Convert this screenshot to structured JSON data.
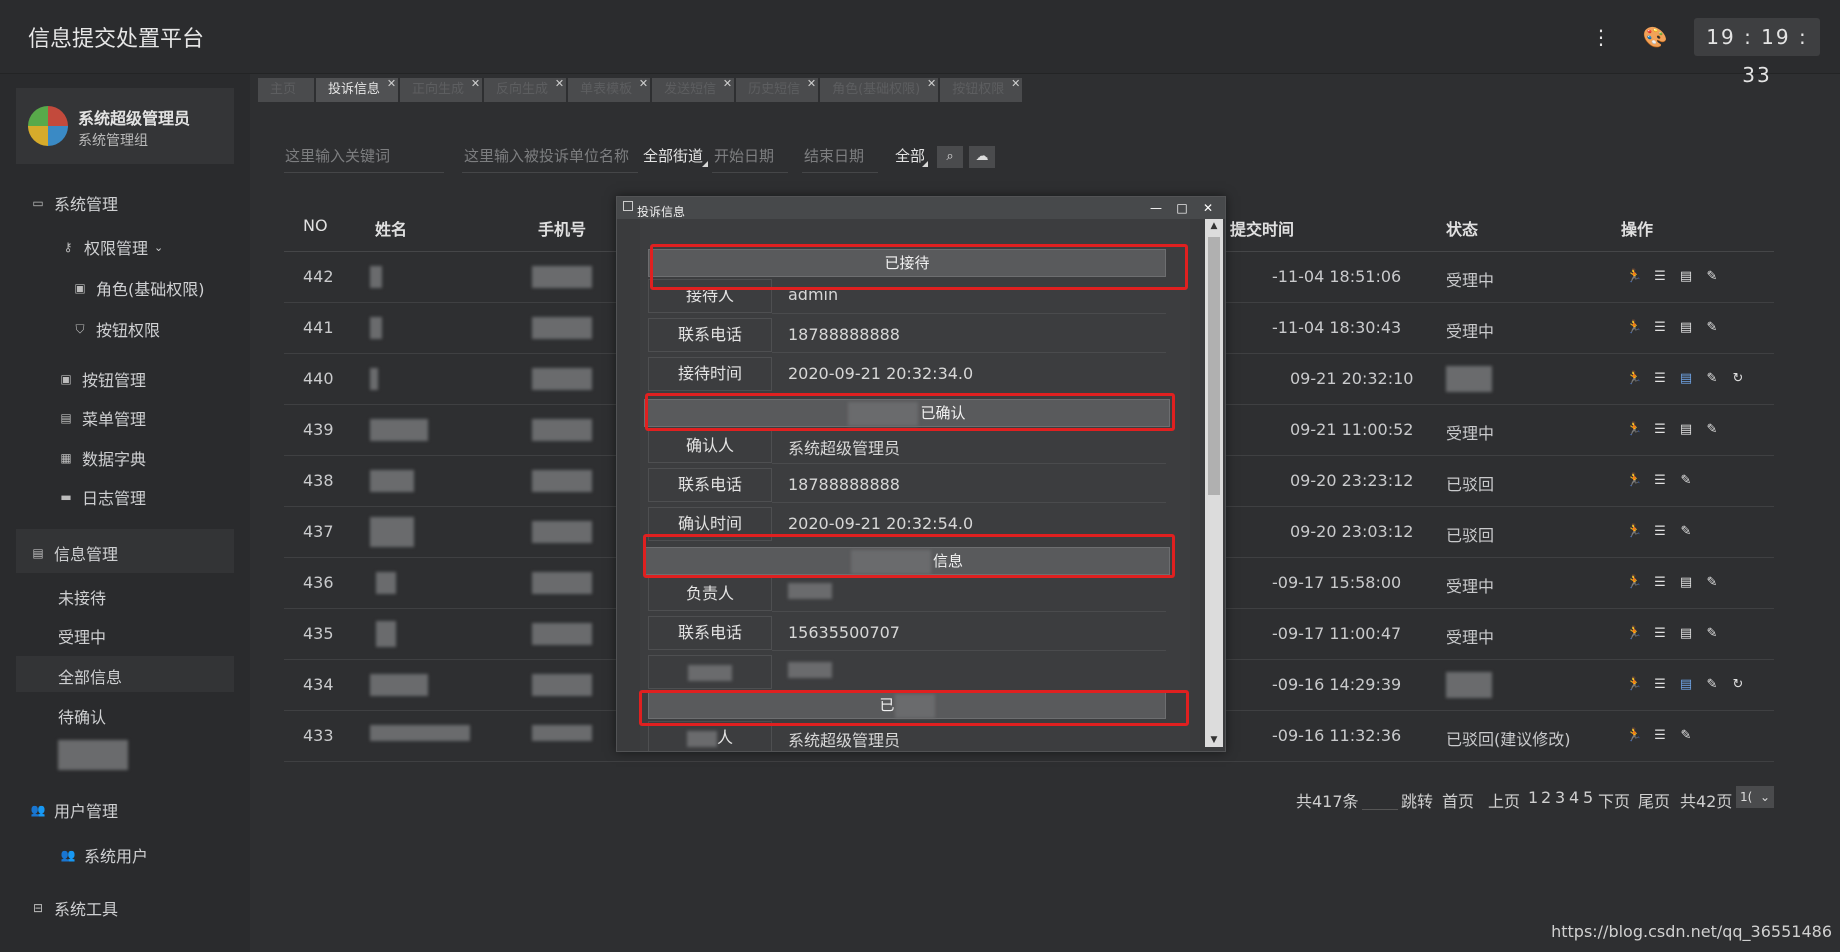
{
  "header": {
    "title": "信息提交处置平台",
    "time": "19 : 19 : 33",
    "more_icon": "more-vertical-icon",
    "theme_icon": "palette-icon"
  },
  "sidebar": {
    "user_name": "系统超级管理员",
    "user_group": "系统管理组",
    "system_mgmt": "系统管理",
    "perm_mgmt": "权限管理",
    "role_perm": "角色(基础权限)",
    "button_perm": "按钮权限",
    "button_mgmt": "按钮管理",
    "menu_mgmt": "菜单管理",
    "data_dict": "数据字典",
    "log_mgmt": "日志管理",
    "info_mgmt": "信息管理",
    "not_received": "未接待",
    "in_process": "受理中",
    "all_info": "全部信息",
    "to_confirm": "待确认",
    "user_mgmt": "用户管理",
    "system_users": "系统用户",
    "system_tools": "系统工具"
  },
  "tabs": [
    "主页",
    "投诉信息",
    "正向生成",
    "反向生成",
    "单表模板",
    "发送短信",
    "历史短信",
    "角色(基础权限)",
    "按钮权限"
  ],
  "filters": {
    "keyword_placeholder": "这里输入关键词",
    "unit_placeholder": "这里输入被投诉单位名称",
    "street": "全部街道",
    "start_date": "开始日期",
    "end_date": "结束日期",
    "status": "全部"
  },
  "table": {
    "headers": {
      "no": "NO",
      "name": "姓名",
      "phone": "手机号",
      "submit_time": "提交时间",
      "status": "状态",
      "actions": "操作"
    },
    "rows": [
      {
        "no": "442",
        "time": "-11-04 18:51:06",
        "status": "受理中"
      },
      {
        "no": "441",
        "time": "-11-04 18:30:43",
        "status": "受理中"
      },
      {
        "no": "440",
        "time": "09-21 20:32:10",
        "status": ""
      },
      {
        "no": "439",
        "time": "09-21 11:00:52",
        "status": "受理中"
      },
      {
        "no": "438",
        "time": "09-20 23:23:12",
        "status": "已驳回"
      },
      {
        "no": "437",
        "time": "09-20 23:03:12",
        "status": "已驳回"
      },
      {
        "no": "436",
        "time": "-09-17 15:58:00",
        "status": "受理中"
      },
      {
        "no": "435",
        "time": "-09-17 11:00:47",
        "status": "受理中"
      },
      {
        "no": "434",
        "time": "-09-16 14:29:39",
        "status": ""
      },
      {
        "no": "433",
        "time": "-09-16 11:32:36",
        "status": "已驳回(建议修改)"
      }
    ]
  },
  "pagination": {
    "total": "共417条",
    "jump": "跳转",
    "first": "首页",
    "prev": "上页",
    "pages": [
      "1",
      "2",
      "3",
      "4",
      "5"
    ],
    "next": "下页",
    "last": "尾页",
    "total_pages": "共42页",
    "page_size": "1("
  },
  "modal": {
    "title": "投诉信息",
    "sections": {
      "received": "已接待",
      "confirmed": "已确认",
      "info": "信息",
      "last": "已"
    },
    "labels": {
      "receiver": "接待人",
      "phone": "联系电话",
      "receive_time": "接待时间",
      "confirmer": "确认人",
      "confirm_time": "确认时间",
      "person_in_charge": "负责人",
      "last_suffix": "人"
    },
    "values": {
      "receiver": "admin",
      "receiver_phone": "18788888888",
      "receive_time": "2020-09-21 20:32:34.0",
      "confirmer": "系统超级管理员",
      "confirmer_phone": "18788888888",
      "confirm_time": "2020-09-21 20:32:54.0",
      "charge_phone": "15635500707",
      "last_person": "系统超级管理员"
    }
  },
  "watermark": "https://blog.csdn.net/qq_36551486"
}
